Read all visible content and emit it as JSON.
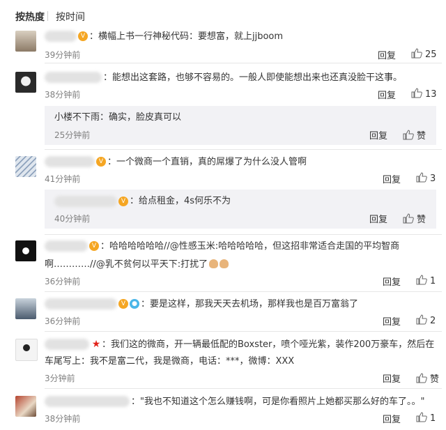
{
  "sort": {
    "hot": "按热度",
    "time": "按时间"
  },
  "comments": [
    {
      "text": "：横幅上书一行神秘代码：要想富，就上jjboom",
      "time": "39分钟前",
      "reply": "回复",
      "likes": "25"
    },
    {
      "text": "：能想出这套路，也够不容易的。一般人即使能想出来也还真没脸干这事。",
      "time": "38分钟前",
      "reply": "回复",
      "likes": "13",
      "sub": {
        "author": "小楼不下雨",
        "text": "：确实，脸皮真可以",
        "time": "25分钟前",
        "reply": "回复",
        "likes": "赞"
      }
    },
    {
      "text": "：一个微商一个直销，真的屌爆了为什么没人管啊",
      "time": "41分钟前",
      "reply": "回复",
      "likes": "3",
      "sub": {
        "text": "：给点租金，4s何乐不为",
        "time": "40分钟前",
        "reply": "回复",
        "likes": "赞"
      }
    },
    {
      "text_line1": "：哈哈哈哈哈哈//@性感玉米:哈哈哈哈哈，但这招非常适合走国的平均智商",
      "text_line2": "啊…………//@乳不贫何以平天下:打扰了",
      "time": "36分钟前",
      "reply": "回复",
      "likes": "1"
    },
    {
      "text": "：要是这样，那我天天去机场，那样我也是百万富翁了",
      "time": "36分钟前",
      "reply": "回复",
      "likes": "2"
    },
    {
      "text_line1": "：我们这的微商，开一辆最低配的Boxster，喷个哑光紫，装作200万豪车，然后在",
      "text_line2": "车尾写上：我不是富二代，我是微商，电话：***，微博：XXX",
      "time": "3分钟前",
      "reply": "回复",
      "likes": "赞"
    },
    {
      "text": "：\"我也不知道这个怎么赚钱啊，可是你看照片上她都买那么好的车了。。\"",
      "time": "38分钟前",
      "reply": "回复",
      "likes": "1"
    }
  ]
}
